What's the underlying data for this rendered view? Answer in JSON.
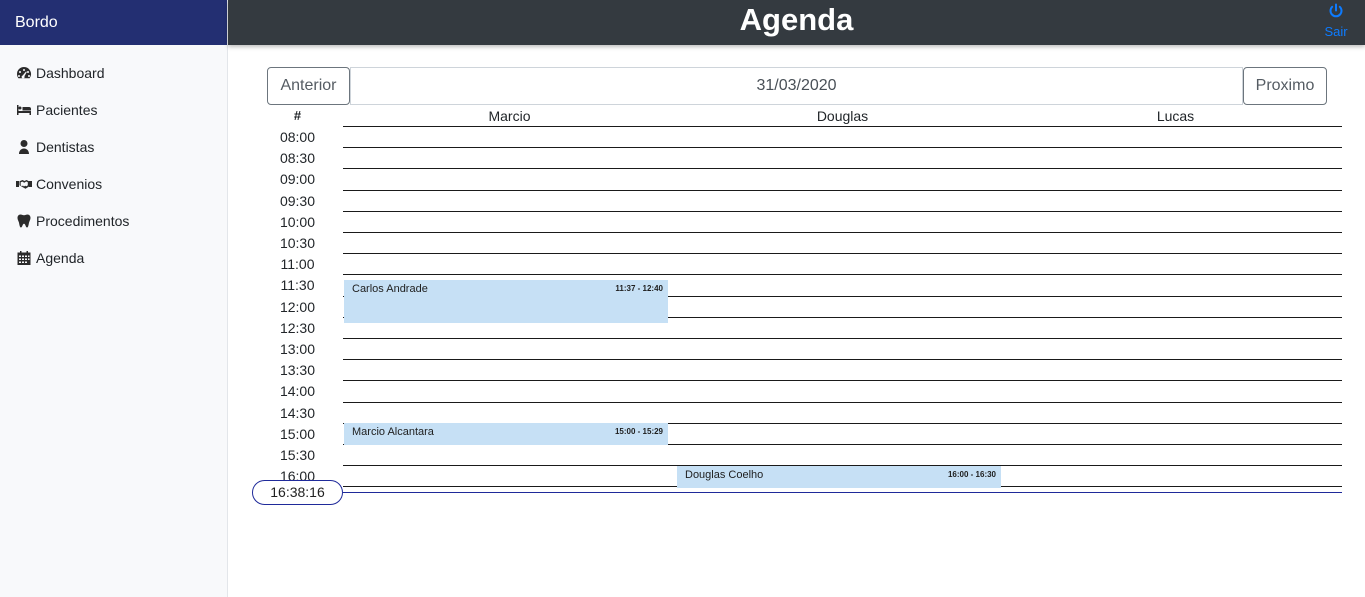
{
  "sidebar": {
    "brand": "Bordo",
    "items": [
      {
        "label": "Dashboard",
        "icon": "tachometer-icon"
      },
      {
        "label": "Pacientes",
        "icon": "bed-icon"
      },
      {
        "label": "Dentistas",
        "icon": "user-md-icon"
      },
      {
        "label": "Convenios",
        "icon": "handshake-icon"
      },
      {
        "label": "Procedimentos",
        "icon": "tooth-icon"
      },
      {
        "label": "Agenda",
        "icon": "calendar-icon"
      }
    ]
  },
  "header": {
    "title": "Agenda",
    "logout_label": "Sair",
    "logout_icon": "power-icon",
    "accent_color": "#0d7bff"
  },
  "date_nav": {
    "prev_label": "Anterior",
    "next_label": "Proximo",
    "date_value": "31/03/2020"
  },
  "schedule": {
    "hash_label": "#",
    "columns": [
      "Marcio",
      "Douglas",
      "Lucas"
    ],
    "times": [
      "08:00",
      "08:30",
      "09:00",
      "09:30",
      "10:00",
      "10:30",
      "11:00",
      "11:30",
      "12:00",
      "12:30",
      "13:00",
      "13:30",
      "14:00",
      "14:30",
      "15:00",
      "15:30",
      "16:00"
    ],
    "current_time": "16:38:16",
    "appointments": [
      {
        "patient": "Carlos Andrade",
        "time": "11:37 - 12:40",
        "column": "Marcio"
      },
      {
        "patient": "Marcio Alcantara",
        "time": "15:00 - 15:29",
        "column": "Marcio"
      },
      {
        "patient": "Douglas Coelho",
        "time": "16:00 - 16:30",
        "column": "Douglas"
      }
    ]
  }
}
